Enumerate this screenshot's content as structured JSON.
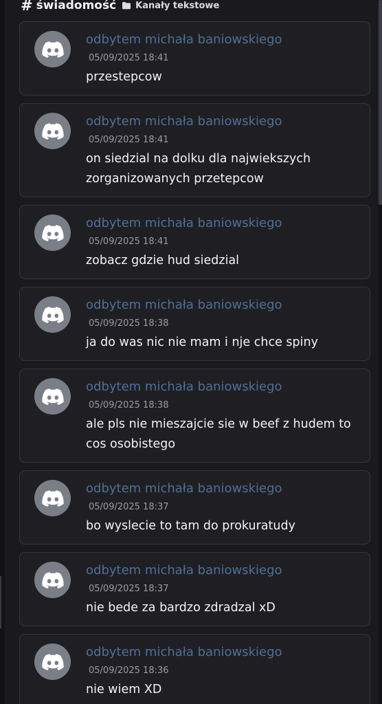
{
  "channel": {
    "hash_glyph": "#",
    "name": "świadomość",
    "category_icon": "folder-icon",
    "category": "Kanały tekstowe"
  },
  "colors": {
    "background": "#1a1a1e",
    "card": "#1f1f23",
    "card_border": "#35363c",
    "author": "#4f6f97",
    "timestamp": "#9c9da3",
    "text": "#f2f3f5",
    "avatar": "#7a7e87"
  },
  "messages": [
    {
      "author": "odbytem michała baniowskiego",
      "timestamp": "05/09/2025 18:41",
      "text": "przestepcow",
      "avatar_icon": "discord-logo-icon"
    },
    {
      "author": "odbytem michała baniowskiego",
      "timestamp": "05/09/2025 18:41",
      "text": "on siedzial na dolku dla najwiekszych zorganizowanych przetepcow",
      "avatar_icon": "discord-logo-icon"
    },
    {
      "author": "odbytem michała baniowskiego",
      "timestamp": "05/09/2025 18:41",
      "text": "zobacz gdzie hud siedzial",
      "avatar_icon": "discord-logo-icon"
    },
    {
      "author": "odbytem michała baniowskiego",
      "timestamp": "05/09/2025 18:38",
      "text": "ja do was nic nie mam i nje chce spiny",
      "avatar_icon": "discord-logo-icon"
    },
    {
      "author": "odbytem michała baniowskiego",
      "timestamp": "05/09/2025 18:38",
      "text": "ale pls nie mieszajcie sie w beef z hudem to cos osobistego",
      "avatar_icon": "discord-logo-icon"
    },
    {
      "author": "odbytem michała baniowskiego",
      "timestamp": "05/09/2025 18:37",
      "text": "bo wyslecie to tam do prokuratudy",
      "avatar_icon": "discord-logo-icon"
    },
    {
      "author": "odbytem michała baniowskiego",
      "timestamp": "05/09/2025 18:37",
      "text": "nie bede za bardzo zdradzal xD",
      "avatar_icon": "discord-logo-icon"
    },
    {
      "author": "odbytem michała baniowskiego",
      "timestamp": "05/09/2025 18:36",
      "text": "nie wiem XD",
      "avatar_icon": "discord-logo-icon"
    }
  ]
}
